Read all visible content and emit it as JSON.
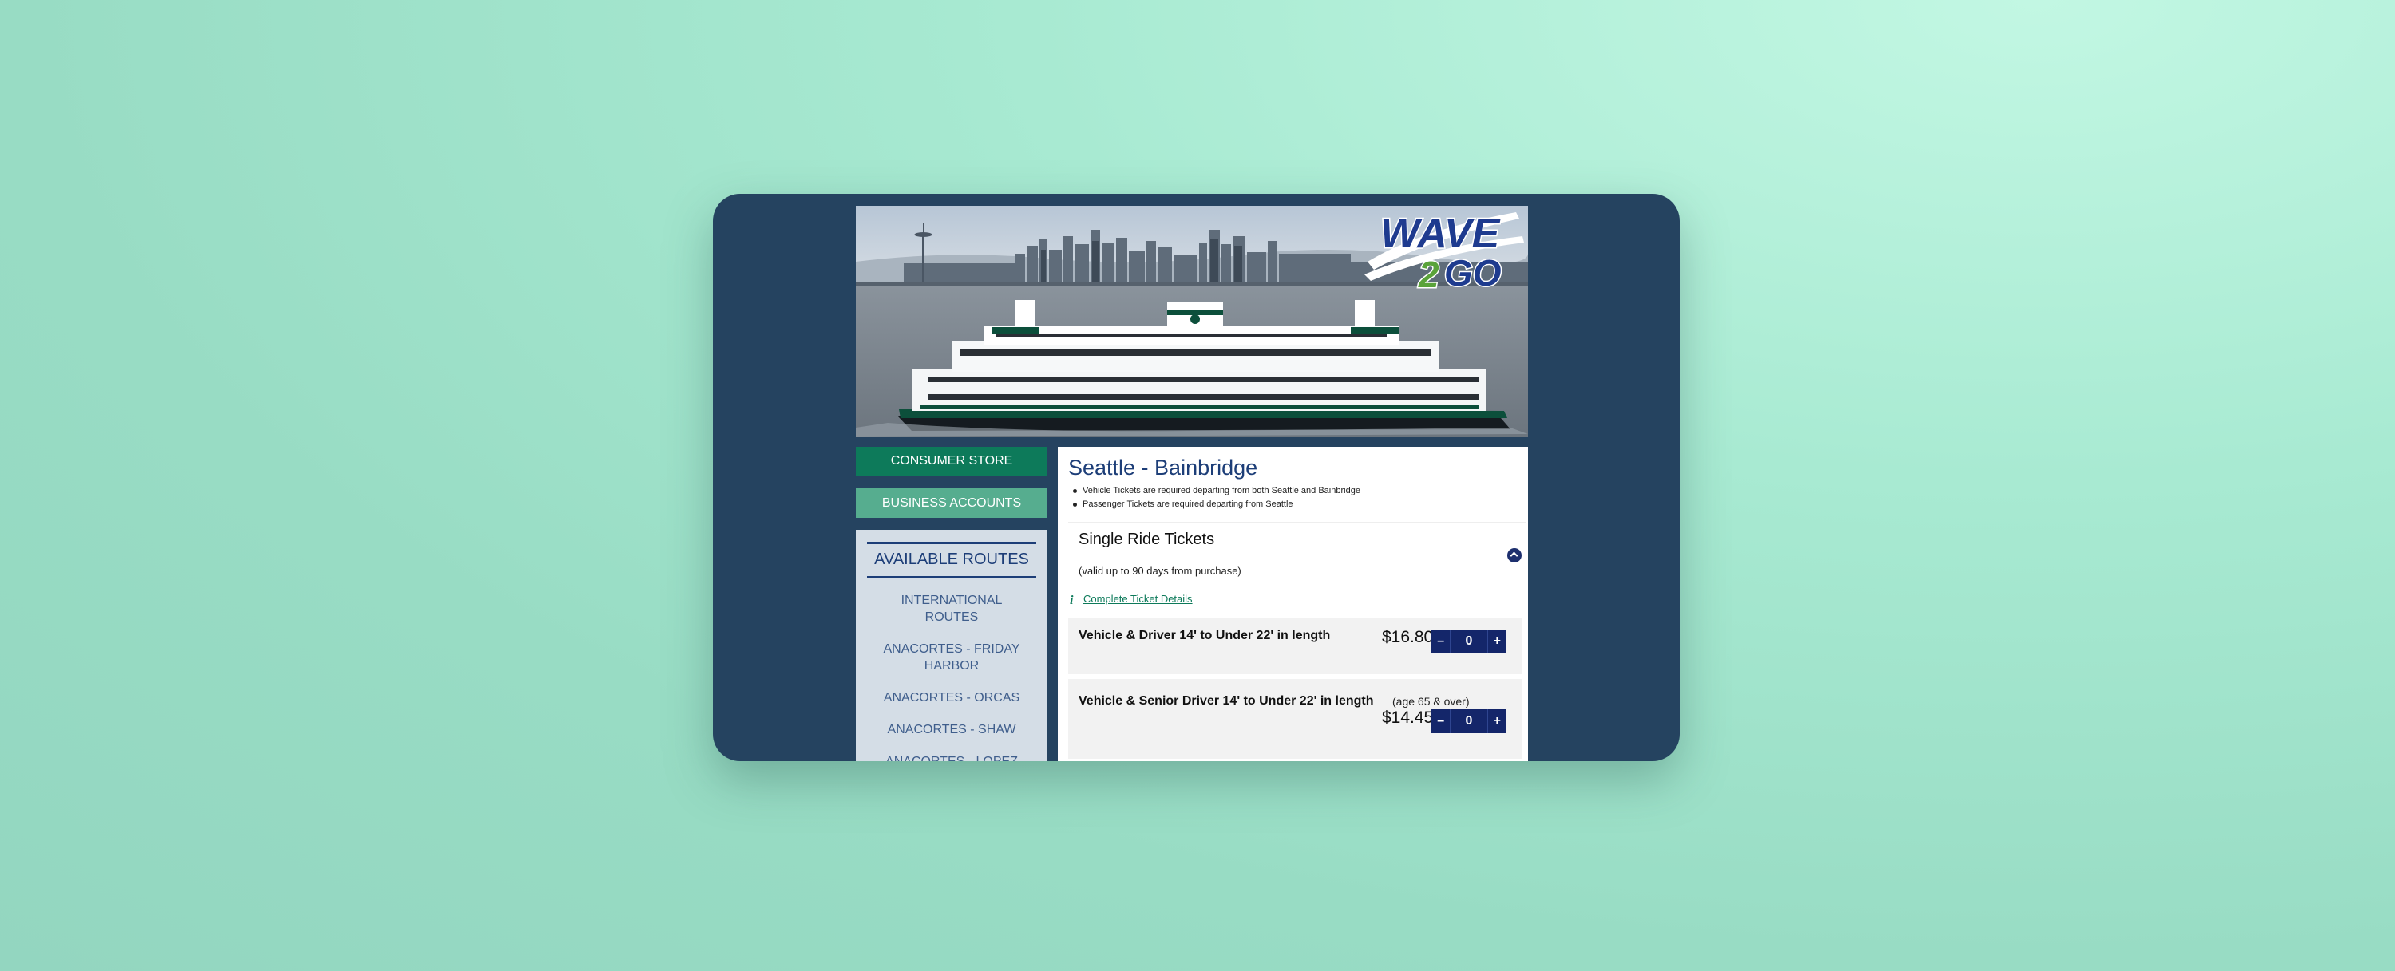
{
  "logo": {
    "wave": "WAVE",
    "two": "2",
    "go": "GO"
  },
  "sidebar": {
    "consumer_store": "CONSUMER STORE",
    "business_accounts": "BUSINESS ACCOUNTS",
    "routes_title": "AVAILABLE ROUTES",
    "routes": [
      "INTERNATIONAL ROUTES",
      "ANACORTES - FRIDAY HARBOR",
      "ANACORTES - ORCAS",
      "ANACORTES - SHAW",
      "ANACORTES - LOPEZ"
    ]
  },
  "main": {
    "title": "Seattle - Bainbridge",
    "notes": [
      "Vehicle Tickets are required departing from both Seattle and Bainbridge",
      "Passenger Tickets are required departing from Seattle"
    ],
    "section": {
      "title": "Single Ride Tickets",
      "validity": "(valid up to 90 days from purchase)",
      "details_link": "Complete Ticket Details",
      "tickets": [
        {
          "name": "Vehicle & Driver 14' to Under 22' in length",
          "note": "",
          "price": "$16.80",
          "quantity": "0"
        },
        {
          "name": "Vehicle & Senior Driver 14' to Under 22' in length",
          "note": "(age 65 & over)",
          "price": "$14.45",
          "quantity": "0"
        }
      ]
    }
  },
  "colors": {
    "frame": "#254360",
    "brand_green": "#0d7a5a",
    "brand_green_light": "#56ad8f",
    "navy": "#1d3e78",
    "stepper": "#14266a"
  },
  "icons": {
    "info": "info-icon",
    "collapse": "chevron-up-icon",
    "minus": "minus-icon",
    "plus": "plus-icon"
  },
  "stepper": {
    "minus": "–",
    "plus": "+"
  }
}
